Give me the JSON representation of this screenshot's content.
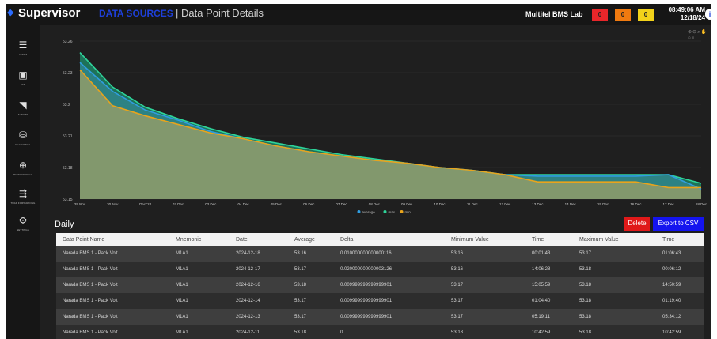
{
  "header": {
    "brand": "Supervisor",
    "breadcrumb_active": "DATA SOURCES",
    "breadcrumb_rest": "| Data Point Details",
    "site_name": "Multitel BMS Lab",
    "alarm_counts": [
      "0",
      "0",
      "0"
    ],
    "alarm_colors": [
      "#e8262a",
      "#f07a10",
      "#f2d21a"
    ],
    "time": "08:49:06 AM",
    "date": "12/18/24",
    "avatar_icon": "user-badge-icon"
  },
  "sidebar": {
    "items": [
      {
        "label": "ASSET",
        "icon": "list-icon"
      },
      {
        "label": "HMI",
        "icon": "image-icon"
      },
      {
        "label": "ALARMS",
        "icon": "megaphone-icon"
      },
      {
        "label": "IO CHANNEL",
        "icon": "database-icon"
      },
      {
        "label": "PASSTHROUGH",
        "icon": "globe-icon"
      },
      {
        "label": "TRAP FORWARDING",
        "icon": "share-icon"
      },
      {
        "label": "SETTINGS",
        "icon": "gear-icon"
      }
    ]
  },
  "chart_data": {
    "type": "area",
    "y_ticks": [
      "53.26",
      "53.23",
      "53.2",
      "53.21",
      "53.18",
      "53.15"
    ],
    "ylim": [
      53.15,
      53.26
    ],
    "x": [
      "29 Nov",
      "30 Nov",
      "Dec '24",
      "02 Dec",
      "03 Dec",
      "04 Dec",
      "05 Dec",
      "06 Dec",
      "07 Dec",
      "08 Dec",
      "09 Dec",
      "10 Dec",
      "11 Dec",
      "12 Dec",
      "13 Dec",
      "14 Dec",
      "15 Dec",
      "16 Dec",
      "17 Dec",
      "18 Dec"
    ],
    "series": [
      {
        "name": "average",
        "color": "#2f9de0",
        "values": [
          53.245,
          53.225,
          53.212,
          53.205,
          53.197,
          53.192,
          53.187,
          53.183,
          53.18,
          53.177,
          53.175,
          53.172,
          53.17,
          53.167,
          53.166,
          53.166,
          53.166,
          53.166,
          53.167,
          53.157
        ]
      },
      {
        "name": "max",
        "color": "#2ed49a",
        "values": [
          53.252,
          53.228,
          53.214,
          53.206,
          53.199,
          53.193,
          53.189,
          53.185,
          53.181,
          53.178,
          53.175,
          53.172,
          53.17,
          53.167,
          53.167,
          53.167,
          53.167,
          53.167,
          53.167,
          53.161
        ]
      },
      {
        "name": "min",
        "color": "#e8a41c",
        "values": [
          53.24,
          53.215,
          53.208,
          53.202,
          53.196,
          53.192,
          53.187,
          53.183,
          53.18,
          53.177,
          53.175,
          53.172,
          53.17,
          53.167,
          53.162,
          53.162,
          53.162,
          53.162,
          53.158,
          53.158
        ]
      }
    ],
    "grid": true,
    "legend": "bottom-center"
  },
  "toolbar_icons": [
    "zoom-in-icon",
    "zoom-out-icon",
    "magnify-icon",
    "pan-icon",
    "home-icon",
    "menu-icon"
  ],
  "section_title": "Daily",
  "actions": {
    "delete": "Delete",
    "export": "Export to CSV"
  },
  "table": {
    "headers": [
      "Data Point Name",
      "Mnemonic",
      "Date",
      "Average",
      "Delta",
      "Minimum Value",
      "Time",
      "Maximum Value",
      "Time"
    ],
    "rows": [
      [
        "Narada BMS 1 - Pack Volt",
        "M1A1",
        "2024-12-18",
        "53.16",
        "0.010000000000000116",
        "53.16",
        "00:01:43",
        "53.17",
        "01:06:43"
      ],
      [
        "Narada BMS 1 - Pack Volt",
        "M1A1",
        "2024-12-17",
        "53.17",
        "0.020000000000003126",
        "53.16",
        "14:06:28",
        "53.18",
        "00:06:12"
      ],
      [
        "Narada BMS 1 - Pack Volt",
        "M1A1",
        "2024-12-16",
        "53.18",
        "0.009999999999999901",
        "53.17",
        "15:05:59",
        "53.18",
        "14:50:59"
      ],
      [
        "Narada BMS 1 - Pack Volt",
        "M1A1",
        "2024-12-14",
        "53.17",
        "0.009999999999999901",
        "53.17",
        "01:04:40",
        "53.18",
        "01:19:40"
      ],
      [
        "Narada BMS 1 - Pack Volt",
        "M1A1",
        "2024-12-13",
        "53.17",
        "0.009999999999999901",
        "53.17",
        "05:19:11",
        "53.18",
        "05:34:12"
      ],
      [
        "Narada BMS 1 - Pack Volt",
        "M1A1",
        "2024-12-11",
        "53.18",
        "0",
        "53.18",
        "10:42:59",
        "53.18",
        "10:42:59"
      ]
    ]
  }
}
